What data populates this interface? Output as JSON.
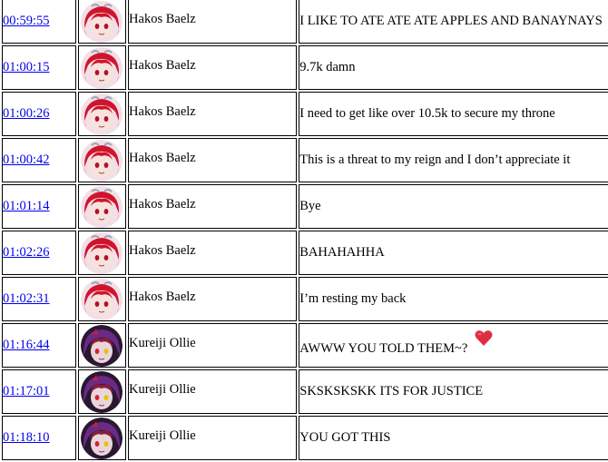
{
  "rows": [
    {
      "time": "00:59:55",
      "author": "Hakos Baelz",
      "avatar": "baelz-avatar",
      "message": "I LIKE TO ATE ATE ATE APPLES AND BANAYNAYS"
    },
    {
      "time": "01:00:15",
      "author": "Hakos Baelz",
      "avatar": "baelz-avatar",
      "message": "9.7k damn"
    },
    {
      "time": "01:00:26",
      "author": "Hakos Baelz",
      "avatar": "baelz-avatar",
      "message": "I need to get like over 10.5k to secure my throne"
    },
    {
      "time": "01:00:42",
      "author": "Hakos Baelz",
      "avatar": "baelz-avatar",
      "message": "This is a threat to my reign and I don’t appreciate it"
    },
    {
      "time": "01:01:14",
      "author": "Hakos Baelz",
      "avatar": "baelz-avatar",
      "message": "Bye"
    },
    {
      "time": "01:02:26",
      "author": "Hakos Baelz",
      "avatar": "baelz-avatar",
      "message": "BAHAHAHHA"
    },
    {
      "time": "01:02:31",
      "author": "Hakos Baelz",
      "avatar": "baelz-avatar",
      "message": "I’m resting my back"
    },
    {
      "time": "01:16:44",
      "author": "Kureiji Ollie",
      "avatar": "ollie-avatar",
      "message": "AWWW YOU TOLD THEM~?",
      "emoji": "red-heart-icon"
    },
    {
      "time": "01:17:01",
      "author": "Kureiji Ollie",
      "avatar": "ollie-avatar",
      "message": "SKSKSKSKK ITS FOR JUSTICE"
    },
    {
      "time": "01:18:10",
      "author": "Kureiji Ollie",
      "avatar": "ollie-avatar",
      "message": "YOU GOT THIS"
    }
  ],
  "colors": {
    "link": "#0000ee",
    "border": "#000000",
    "baelz_bg": "#f3dfe6",
    "baelz_hair": "#d0142c",
    "ollie_bg": "#2a1830",
    "ollie_hair": "#6a2a86",
    "heart": "#dd2e44"
  }
}
